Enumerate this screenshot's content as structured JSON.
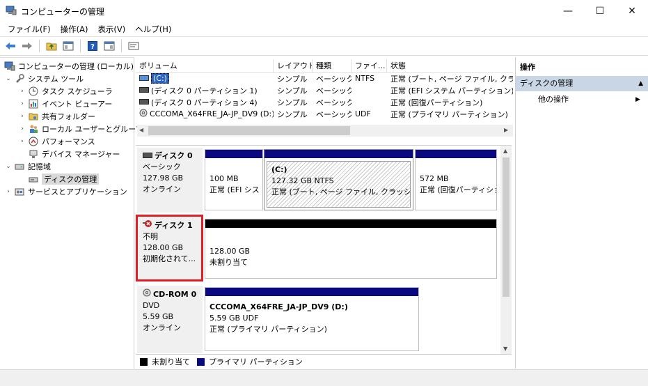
{
  "window": {
    "title": "コンピューターの管理",
    "minimize": "—",
    "maximize": "☐",
    "close": "✕"
  },
  "menu": [
    "ファイル(F)",
    "操作(A)",
    "表示(V)",
    "ヘルプ(H)"
  ],
  "tree": [
    {
      "label": "コンピューターの管理 (ローカル)",
      "icon": "computer-icon",
      "level": 0,
      "chevron": ""
    },
    {
      "label": "システム ツール",
      "icon": "tools-icon",
      "level": 1,
      "chevron": "⌄"
    },
    {
      "label": "タスク スケジューラ",
      "icon": "clock-icon",
      "level": 2,
      "chevron": "›"
    },
    {
      "label": "イベント ビューアー",
      "icon": "event-viewer-icon",
      "level": 2,
      "chevron": "›"
    },
    {
      "label": "共有フォルダー",
      "icon": "shared-folder-icon",
      "level": 2,
      "chevron": "›"
    },
    {
      "label": "ローカル ユーザーとグループ",
      "icon": "users-icon",
      "level": 2,
      "chevron": "›"
    },
    {
      "label": "パフォーマンス",
      "icon": "performance-icon",
      "level": 2,
      "chevron": "›"
    },
    {
      "label": "デバイス マネージャー",
      "icon": "device-manager-icon",
      "level": 2,
      "chevron": ""
    },
    {
      "label": "記憶域",
      "icon": "storage-icon",
      "level": 1,
      "chevron": "⌄"
    },
    {
      "label": "ディスクの管理",
      "icon": "disk-management-icon",
      "level": 2,
      "chevron": "",
      "selected": true
    },
    {
      "label": "サービスとアプリケーション",
      "icon": "services-icon",
      "level": 1,
      "chevron": "›"
    }
  ],
  "volume_table": {
    "headers": [
      "ボリューム",
      "レイアウト",
      "種類",
      "ファイ...",
      "状態"
    ],
    "rows": [
      [
        "(C:)",
        "シンプル",
        "ベーシック",
        "NTFS",
        "正常 (ブート, ページ ファイル, クラッシュ"
      ],
      [
        "(ディスク 0 パーティション 1)",
        "シンプル",
        "ベーシック",
        "",
        "正常 (EFI システム パーティション)"
      ],
      [
        "(ディスク 0 パーティション 4)",
        "シンプル",
        "ベーシック",
        "",
        "正常 (回復パーティション)"
      ],
      [
        "CCCOMA_X64FRE_JA-JP_DV9 (D:)",
        "シンプル",
        "ベーシック",
        "UDF",
        "正常 (プライマリ パーティション)"
      ]
    ]
  },
  "disks": {
    "disk0": {
      "name": "ディスク 0",
      "type": "ベーシック",
      "size": "127.98 GB",
      "status": "オンライン",
      "partitions": [
        {
          "title": "",
          "size": "100 MB",
          "status": "正常 (EFI シス"
        },
        {
          "title": "(C:)",
          "size": "127.32 GB NTFS",
          "status": "正常 (ブート, ページ ファイル, クラッシュ ダンプ"
        },
        {
          "title": "",
          "size": "572 MB",
          "status": "正常 (回復パーティショ"
        }
      ]
    },
    "disk1": {
      "name": "ディスク 1",
      "type": "不明",
      "size": "128.00 GB",
      "status": "初期化されて...",
      "partitions": [
        {
          "title": "",
          "size": "128.00 GB",
          "status": "未割り当て"
        }
      ]
    },
    "cdrom0": {
      "name": "CD-ROM 0",
      "type": "DVD",
      "size": "5.59 GB",
      "status": "オンライン",
      "partitions": [
        {
          "title": "CCCOMA_X64FRE_JA-JP_DV9 (D:)",
          "size": "5.59 GB UDF",
          "status": "正常 (プライマリ パーティション)"
        }
      ]
    }
  },
  "legend": {
    "unallocated": "未割り当て",
    "primary": "プライマリ パーティション"
  },
  "actions": {
    "title": "操作",
    "section": "ディスクの管理",
    "more": "他の操作"
  },
  "colors": {
    "primary_bar": "#0a0a80",
    "unallocated_bar": "#000000",
    "highlight": "#e11f26",
    "action_section": "#c9d6e6"
  }
}
